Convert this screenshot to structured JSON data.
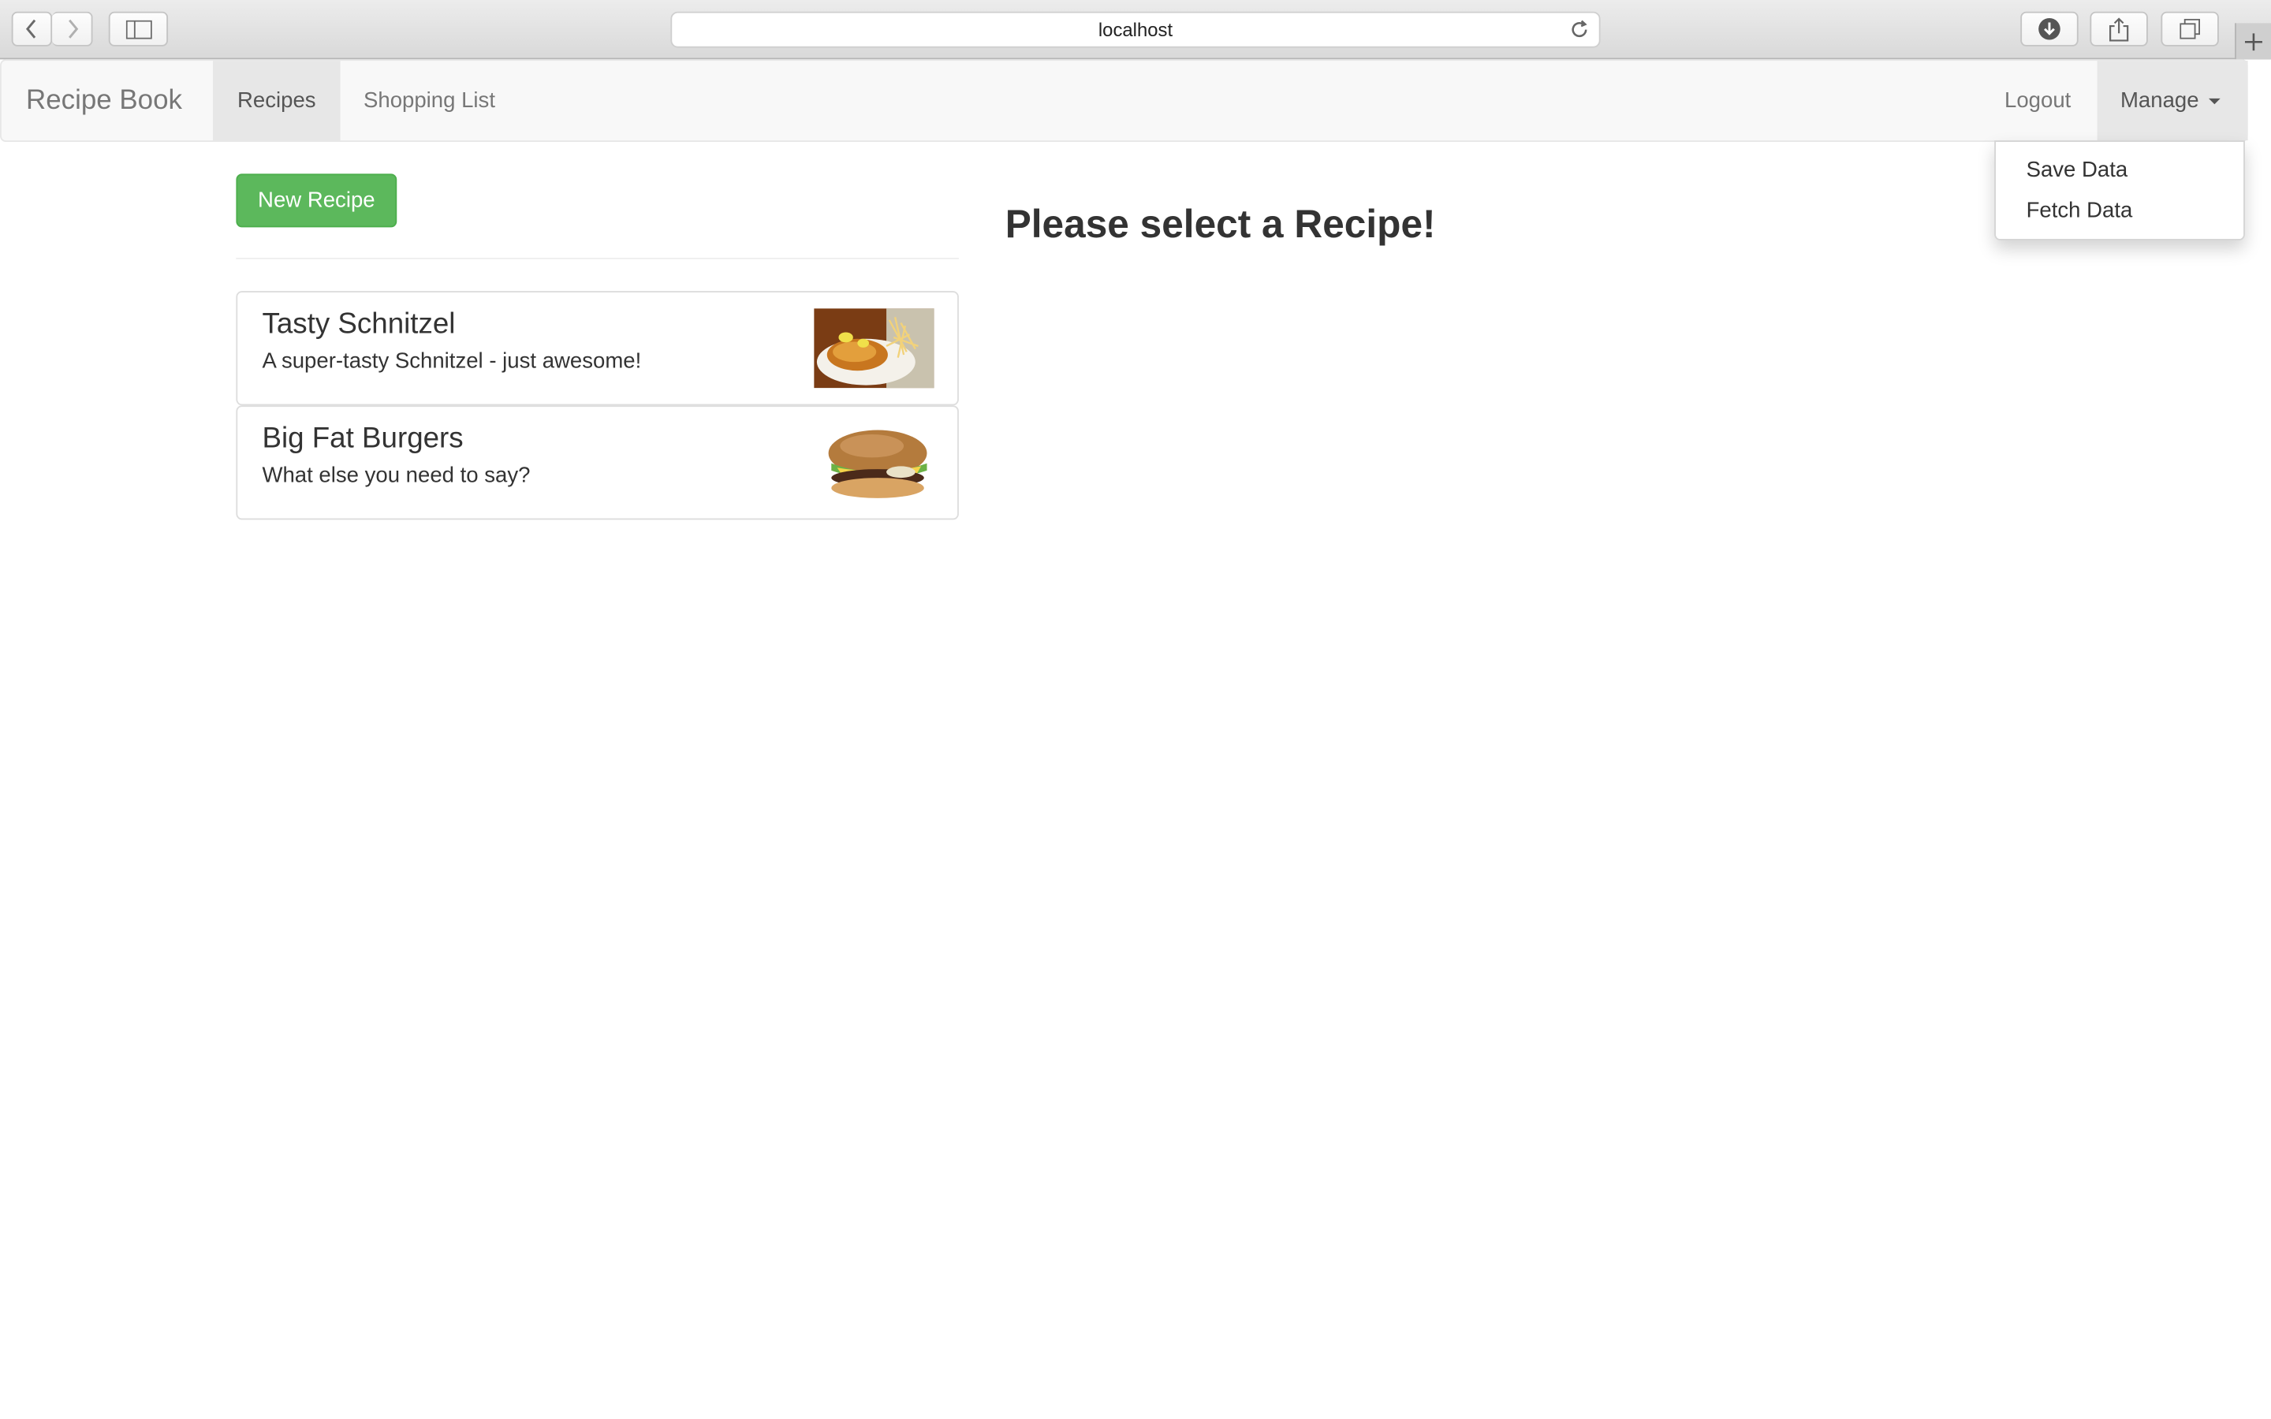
{
  "browser": {
    "url": "localhost",
    "icons": [
      "back-icon",
      "forward-icon",
      "sidebar-icon",
      "reload-icon",
      "download-icon",
      "share-icon",
      "tabs-icon",
      "plus-icon"
    ]
  },
  "navbar": {
    "brand": "Recipe Book",
    "links": [
      {
        "label": "Recipes",
        "active": true
      },
      {
        "label": "Shopping List",
        "active": false
      }
    ],
    "logout": "Logout",
    "manage": "Manage",
    "dropdown": [
      "Save Data",
      "Fetch Data"
    ]
  },
  "main": {
    "new_recipe_label": "New Recipe",
    "new_recipe_color": "#5cb85c",
    "recipes": [
      {
        "name": "Tasty Schnitzel",
        "description": "A super-tasty Schnitzel - just awesome!",
        "image": "schnitzel-image"
      },
      {
        "name": "Big Fat Burgers",
        "description": "What else you need to say?",
        "image": "burger-image"
      }
    ],
    "detail_placeholder": "Please select a Recipe!"
  }
}
